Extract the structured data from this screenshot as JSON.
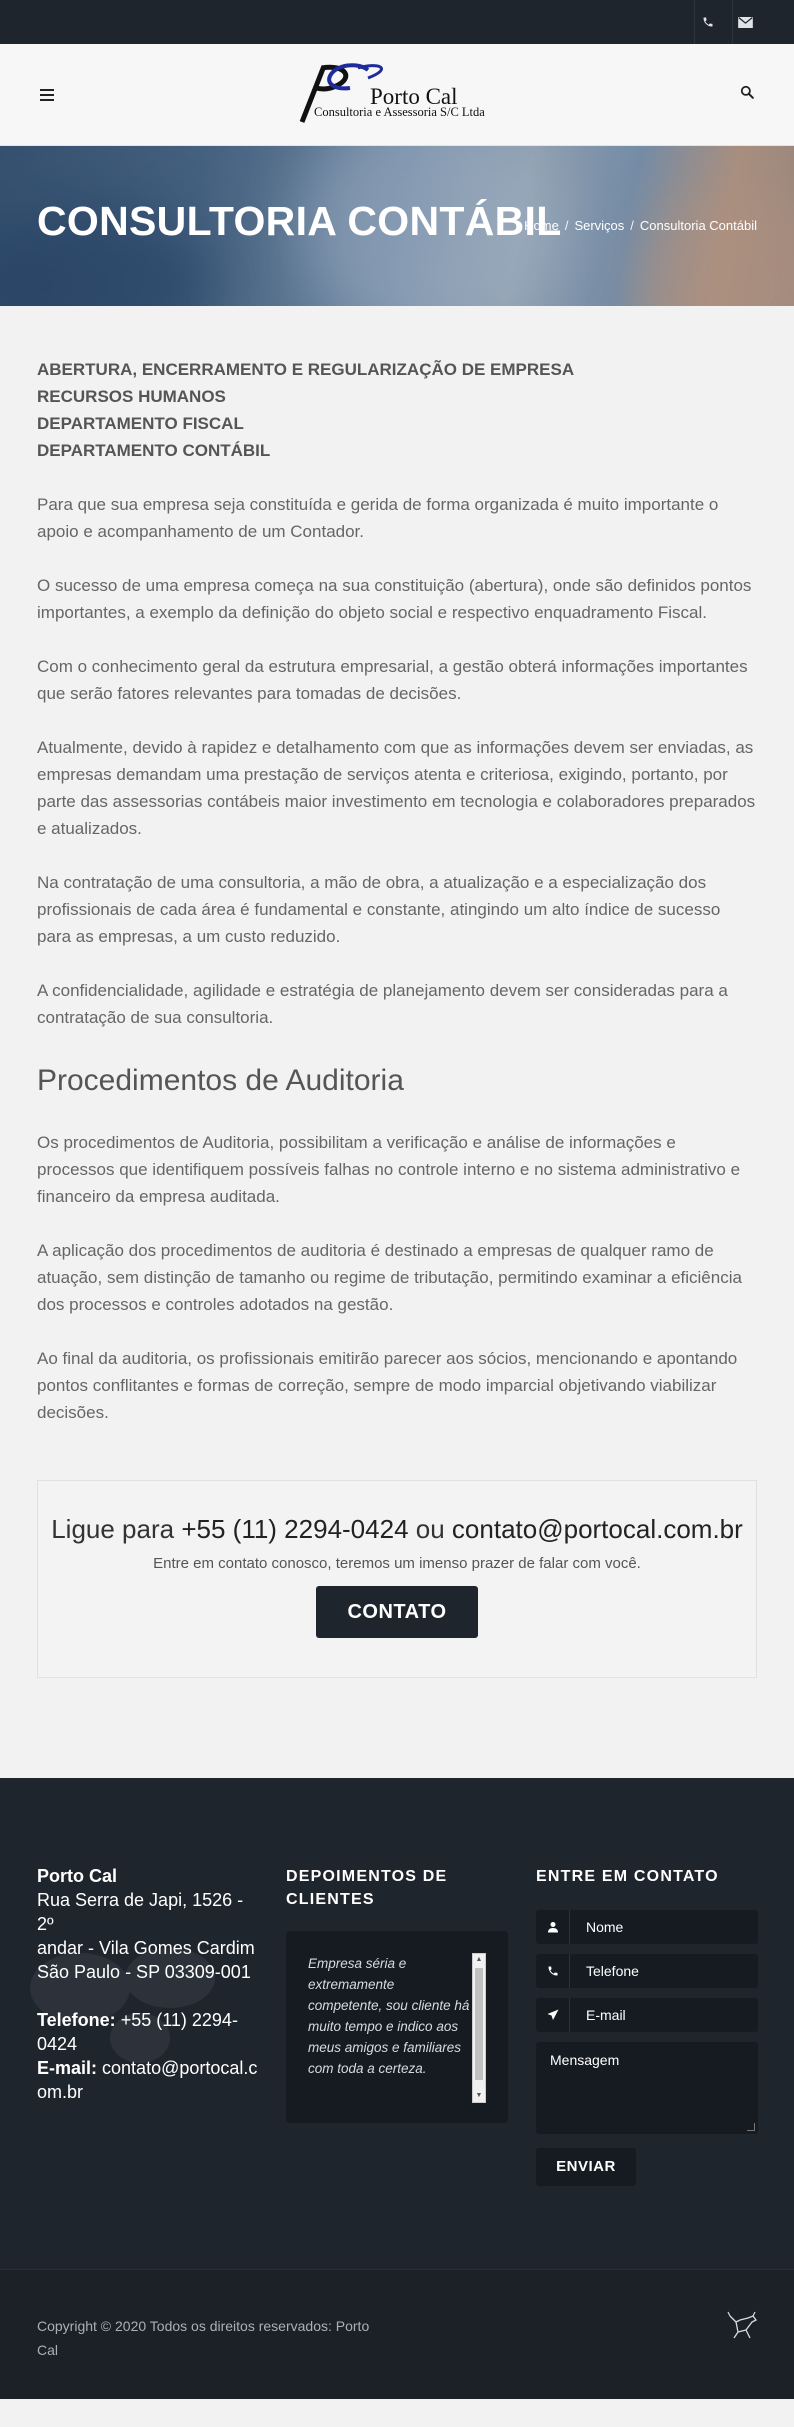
{
  "topbar": {
    "phone_icon": "phone-icon",
    "mail_icon": "mail-icon"
  },
  "header": {
    "logo_mark": "PC",
    "logo_name": "Porto Cal",
    "logo_sub": "Consultoria e Assessoria S/C Ltda",
    "menu_icon": "hamburger-icon",
    "search_icon": "search-icon"
  },
  "title_band": {
    "title": "CONSULTORIA CONTÁBIL",
    "breadcrumb": [
      "Home",
      "Serviços",
      "Consultoria Contábil"
    ],
    "separator": "/"
  },
  "content": {
    "services": [
      "ABERTURA, ENCERRAMENTO E REGULARIZAÇÃO DE EMPRESA",
      "RECURSOS HUMANOS",
      "DEPARTAMENTO FISCAL",
      "DEPARTAMENTO CONTÁBIL"
    ],
    "paragraphs": [
      "Para que sua empresa seja constituída e gerida de forma organizada é muito importante o apoio e acompanhamento de um Contador.",
      "O sucesso de uma empresa começa na sua constituição (abertura), onde são definidos pontos importantes, a exemplo da definição do objeto social e respectivo enquadramento Fiscal.",
      "Com o conhecimento geral da estrutura empresarial, a gestão obterá informações importantes que serão fatores relevantes para tomadas de decisões.",
      "Atualmente, devido à rapidez e detalhamento com que as informações devem ser enviadas, as empresas demandam uma prestação de serviços atenta e criteriosa, exigindo, portanto, por parte das assessorias contábeis maior investimento em tecnologia e colaboradores preparados e atualizados.",
      "Na contratação de uma consultoria, a mão de obra, a atualização e a especialização dos profissionais de cada área é fundamental e constante, atingindo um alto índice de sucesso para as empresas, a um custo reduzido.",
      "A confidencialidade, agilidade e estratégia de planejamento devem ser consideradas para a contratação de sua consultoria."
    ],
    "audit_heading": "Procedimentos de Auditoria",
    "audit_paragraphs": [
      "Os procedimentos de Auditoria, possibilitam a verificação e análise de informações e processos que identifiquem possíveis falhas no controle interno e no sistema administrativo e financeiro da empresa auditada.",
      "A aplicação dos procedimentos de auditoria é destinado a empresas de qualquer ramo de atuação, sem distinção de tamanho ou regime de tributação, permitindo examinar a eficiência dos processos e controles adotados na gestão.",
      "Ao final da auditoria, os profissionais emitirão parecer aos sócios, mencionando e apontando pontos conflitantes e formas de correção, sempre de modo imparcial objetivando viabilizar decisões."
    ]
  },
  "cta": {
    "prefix": "Ligue para",
    "phone": "+55 (11) 2294-0424",
    "or": "ou",
    "email": "contato@portocal.com.br",
    "subtitle": "Entre em contato conosco, teremos um imenso prazer de falar com você.",
    "button": "CONTATO"
  },
  "footer": {
    "company": "Porto Cal",
    "address": [
      "Rua Serra de Japi, 1526 - 2º",
      "andar - Vila Gomes Cardim",
      "São Paulo - SP 03309-001"
    ],
    "phone_label": "Telefone:",
    "phone": "+55 (11) 2294-0424",
    "email_label": "E-mail:",
    "email": "contato@portocal.com.br",
    "testimonials_heading": "DEPOIMENTOS DE CLIENTES",
    "testimonial": "Empresa séria e extremamente competente, sou cliente há muito tempo e indico aos meus amigos e familiares com toda a certeza.",
    "contact_heading": "ENTRE EM CONTATO",
    "form": {
      "name_placeholder": "Nome",
      "phone_placeholder": "Telefone",
      "email_placeholder": "E-mail",
      "message_placeholder": "Mensagem",
      "send_button": "ENVIAR"
    },
    "copyright": "Copyright © 2020 Todos os direitos reservados: Porto Cal"
  }
}
